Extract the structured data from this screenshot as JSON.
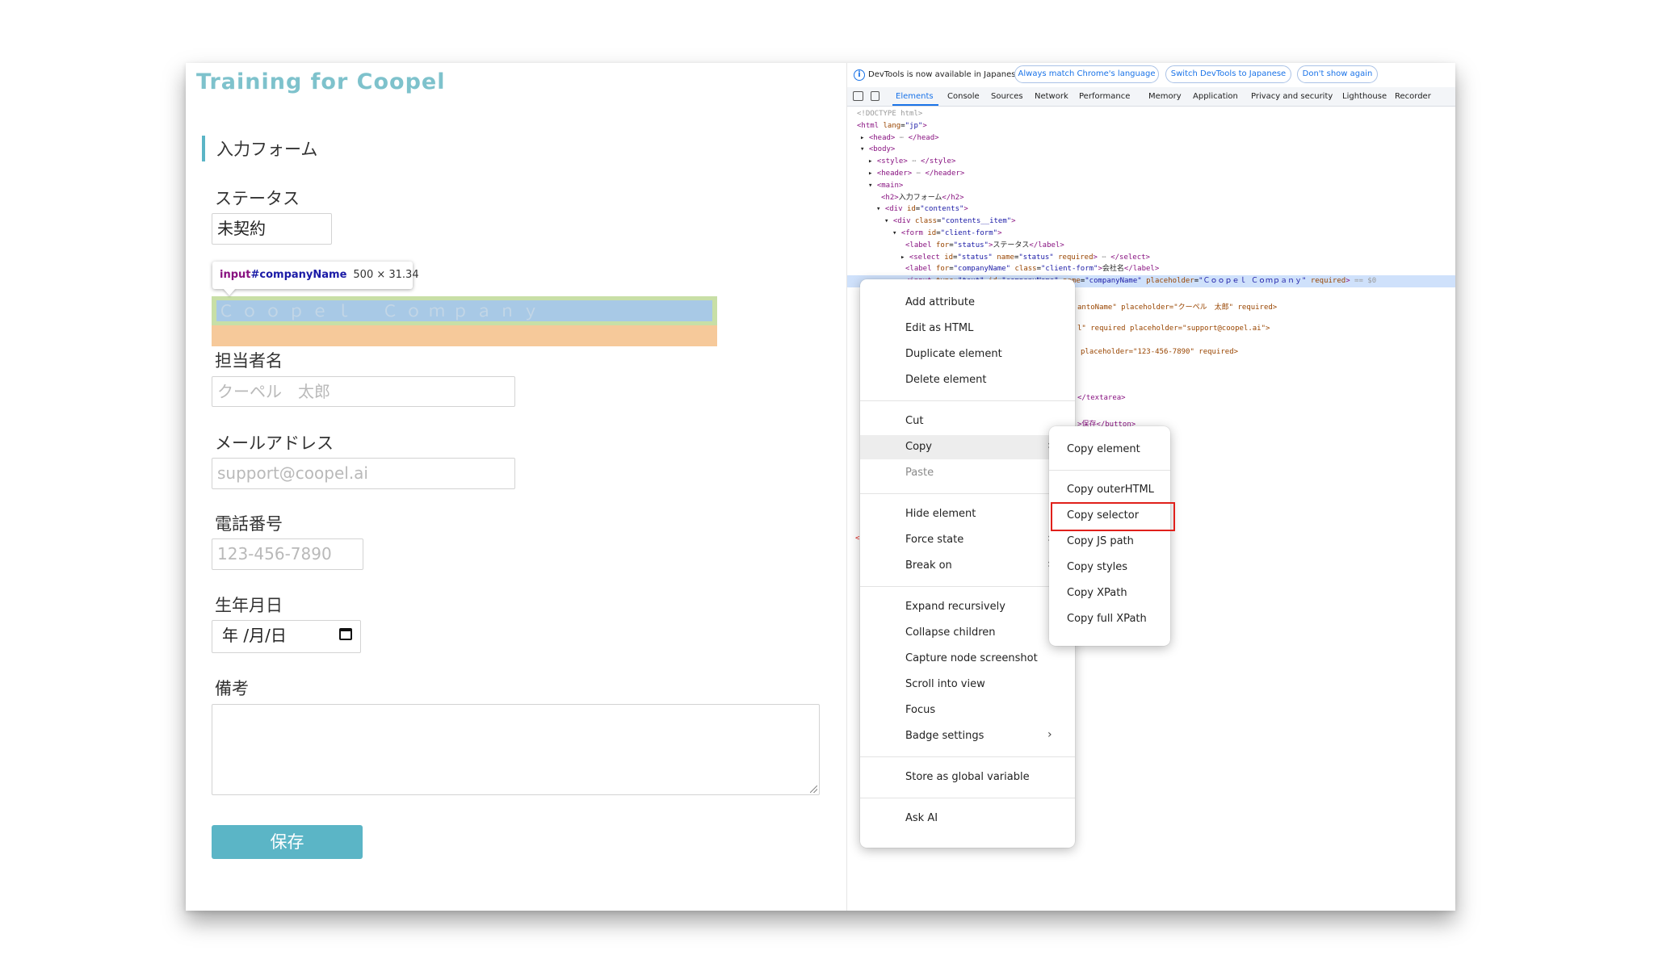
{
  "page": {
    "site_title": "Training for Coopel",
    "section_title": "入力フォーム",
    "form": {
      "status_label": "ステータス",
      "status_value": "未契約",
      "company_placeholder": "Ｃｏｏｐｅｌ　Ｃｏｍｐａｎｙ",
      "contact_label": "担当者名",
      "contact_placeholder": "クーペル　太郎",
      "email_label": "メールアドレス",
      "email_placeholder": "support@coopel.ai",
      "phone_label": "電話番号",
      "phone_placeholder": "123-456-7890",
      "birth_label": "生年月日",
      "birth_value": "年 /月/日",
      "notes_label": "備考",
      "save_label": "保存"
    },
    "inspect_tooltip": {
      "tag": "input",
      "id": "#companyName",
      "size": "500 × 31.34"
    }
  },
  "devtools": {
    "infobar": {
      "message": "DevTools is now available in Japanese!",
      "btn_match": "Always match Chrome's language",
      "btn_switch": "Switch DevTools to Japanese",
      "btn_dont": "Don't show again"
    },
    "tabs": [
      "Elements",
      "Console",
      "Sources",
      "Network",
      "Performance",
      "Memory",
      "Application",
      "Privacy and security",
      "Lighthouse",
      "Recorder"
    ],
    "dom_tail": {
      "line1": "antoName\" placeholder=\"クーペル　太郎\" required>",
      "line2": "l\" required placeholder=\"support@coopel.ai\">",
      "line3": "placeholder=\"123-456-7890\" required>",
      "line4": "</textarea>",
      "line5": ">保存</button>",
      "line6": "<"
    },
    "selected_suffix": "== $0",
    "context_menu": {
      "add_attribute": "Add attribute",
      "edit_as_html": "Edit as HTML",
      "duplicate_element": "Duplicate element",
      "delete_element": "Delete element",
      "cut": "Cut",
      "copy": "Copy",
      "paste": "Paste",
      "hide_element": "Hide element",
      "force_state": "Force state",
      "break_on": "Break on",
      "expand_recursively": "Expand recursively",
      "collapse_children": "Collapse children",
      "capture_node_screenshot": "Capture node screenshot",
      "scroll_into_view": "Scroll into view",
      "focus": "Focus",
      "badge_settings": "Badge settings",
      "store_as_global_variable": "Store as global variable",
      "ask_ai": "Ask AI"
    },
    "copy_submenu": {
      "copy_element": "Copy element",
      "copy_outer_html": "Copy outerHTML",
      "copy_selector": "Copy selector",
      "copy_js_path": "Copy JS path",
      "copy_styles": "Copy styles",
      "copy_xpath": "Copy XPath",
      "copy_full_xpath": "Copy full XPath"
    }
  }
}
